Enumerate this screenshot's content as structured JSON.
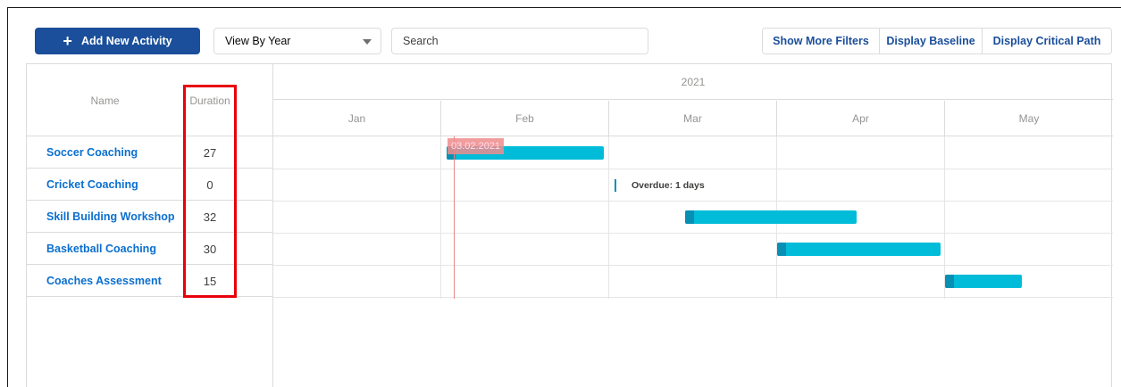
{
  "toolbar": {
    "add_label": "Add New Activity",
    "view_select_value": "View By Year",
    "search_placeholder": "Search",
    "show_filters_label": "Show More Filters",
    "display_baseline_label": "Display Baseline",
    "display_critical_path_label": "Display Critical Path"
  },
  "grid": {
    "name_header": "Name",
    "duration_header": "Duration",
    "rows": [
      {
        "name": "Soccer Coaching",
        "duration": "27"
      },
      {
        "name": "Cricket Coaching",
        "duration": "0"
      },
      {
        "name": "Skill Building Workshop",
        "duration": "32"
      },
      {
        "name": "Basketball Coaching",
        "duration": "30"
      },
      {
        "name": "Coaches Assessment",
        "duration": "15"
      }
    ]
  },
  "timeline": {
    "year": "2021",
    "months": [
      "Jan",
      "Feb",
      "Mar",
      "Apr",
      "May"
    ],
    "today_label": "03.02.2021",
    "overdue_text": "Overdue: 1 days"
  },
  "colors": {
    "primary": "#1b4f9b",
    "link": "#0b6fcf",
    "bar": "#00bcd9",
    "bar_start": "#0790b3",
    "highlight": "#e8000b",
    "today": "#e88787"
  }
}
